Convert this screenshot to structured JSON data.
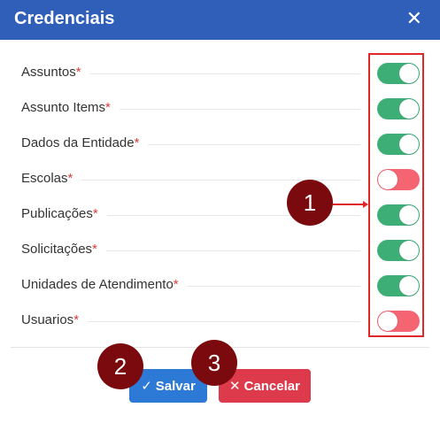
{
  "dialog": {
    "title": "Credenciais",
    "close_label": "✕"
  },
  "rows": [
    {
      "label": "Assuntos",
      "required": "*",
      "state": "on"
    },
    {
      "label": "Assunto Items",
      "required": "*",
      "state": "on"
    },
    {
      "label": "Dados da Entidade",
      "required": "*",
      "state": "on"
    },
    {
      "label": "Escolas",
      "required": "*",
      "state": "off"
    },
    {
      "label": "Publicações",
      "required": "*",
      "state": "on"
    },
    {
      "label": "Solicitações",
      "required": "*",
      "state": "on"
    },
    {
      "label": "Unidades de Atendimento",
      "required": "*",
      "state": "on"
    },
    {
      "label": "Usuarios",
      "required": "*",
      "state": "off"
    }
  ],
  "buttons": {
    "save_icon": "✓",
    "save_label": "Salvar",
    "cancel_icon": "✕",
    "cancel_label": "Cancelar"
  },
  "annotations": {
    "badge1": "1",
    "badge2": "2",
    "badge3": "3"
  },
  "colors": {
    "header": "#2f5fb8",
    "toggle_on": "#3dae76",
    "toggle_off": "#f46471",
    "save": "#2d7ad6",
    "cancel": "#dd3a4c",
    "badge": "#7a0a0e",
    "highlight": "#e02828"
  }
}
